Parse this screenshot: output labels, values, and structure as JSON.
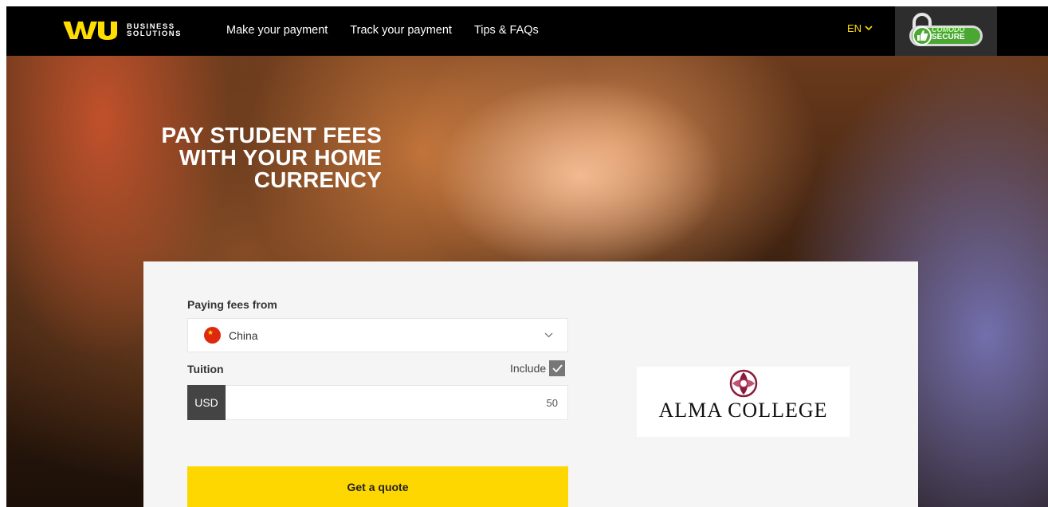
{
  "header": {
    "logo_mark": "WU",
    "logo_line1": "BUSINESS",
    "logo_line2": "SOLUTIONS",
    "nav": [
      {
        "label": "Make your payment"
      },
      {
        "label": "Track your payment"
      },
      {
        "label": "Tips & FAQs"
      }
    ],
    "language": "EN",
    "secure_badge": {
      "line1": "COMODO",
      "line2": "SECURE"
    }
  },
  "hero": {
    "title_line1": "PAY STUDENT FEES",
    "title_line2": "WITH YOUR HOME",
    "title_line3": "CURRENCY"
  },
  "form": {
    "paying_from_label": "Paying fees from",
    "country": "China",
    "tuition_label": "Tuition",
    "include_label": "Include",
    "include_checked": true,
    "currency": "USD",
    "amount": "50",
    "submit_label": "Get a quote"
  },
  "college": {
    "name": "ALMA COLLEGE"
  },
  "colors": {
    "brand_yellow": "#ffd700",
    "header_bg": "#000000",
    "card_bg": "#f5f5f5",
    "language_color": "#ffdd00"
  }
}
